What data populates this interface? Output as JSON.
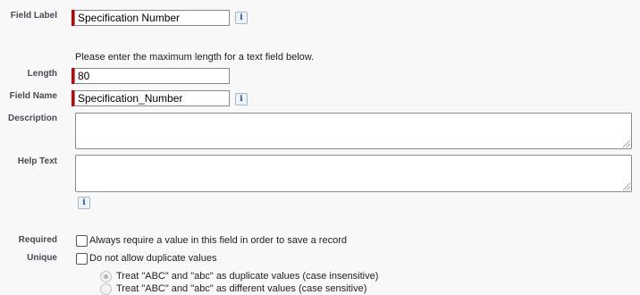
{
  "field_label": {
    "label": "Field Label",
    "value": "Specification Number",
    "info_icon": "info-icon"
  },
  "length": {
    "note": "Please enter the maximum length for a text field below.",
    "label": "Length",
    "value": "80"
  },
  "field_name": {
    "label": "Field Name",
    "value": "Specification_Number",
    "info_icon": "info-icon"
  },
  "description": {
    "label": "Description",
    "value": ""
  },
  "help_text": {
    "label": "Help Text",
    "value": "",
    "info_icon": "info-icon"
  },
  "required": {
    "label": "Required",
    "checkbox_label": "Always require a value in this field in order to save a record",
    "checked": false
  },
  "unique": {
    "label": "Unique",
    "checkbox_label": "Do not allow duplicate values",
    "checked": false,
    "options": [
      {
        "label": "Treat \"ABC\" and \"abc\" as duplicate values (case insensitive)",
        "selected": true,
        "disabled": true
      },
      {
        "label": "Treat \"ABC\" and \"abc\" as different values (case sensitive)",
        "selected": false,
        "disabled": true
      }
    ]
  },
  "colors": {
    "required_marker": "#cc0000",
    "info_icon": "#1d4f91",
    "background": "#f8f8f8"
  }
}
